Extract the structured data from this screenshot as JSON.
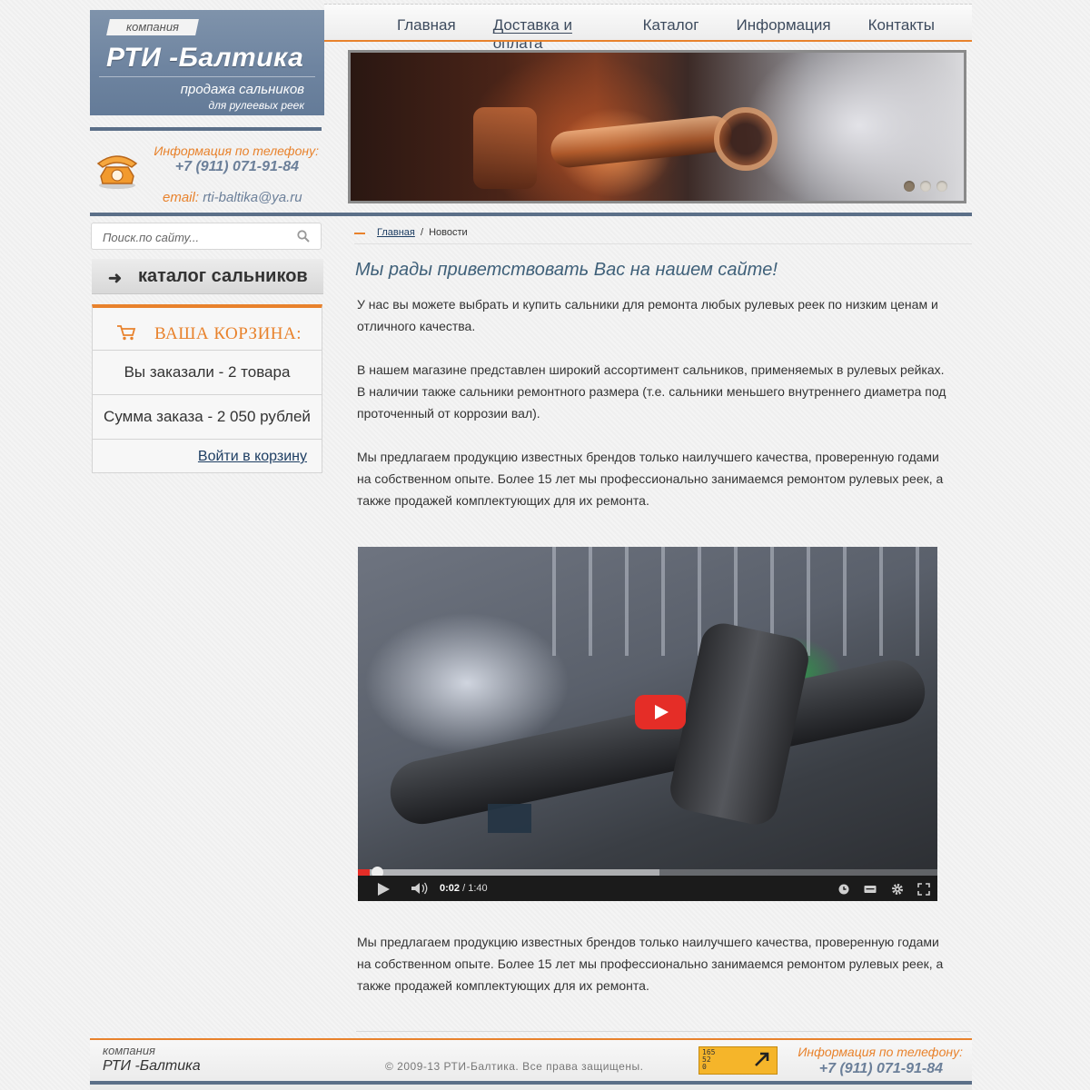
{
  "header": {
    "company_tag": "компания",
    "company_name": "РТИ -Балтика",
    "subtitle_1": "продажа сальников",
    "subtitle_2": "для рулеевых реек",
    "phone_label": "Информация по телефону:",
    "phone": "+7 (911) 071-91-84",
    "email_label": "email:",
    "email": "rti-baltika@ya.ru"
  },
  "nav": {
    "items": [
      "Главная",
      "Доставка и оплата",
      "Каталог",
      "Информация",
      "Контакты"
    ],
    "active": "Доставка и оплата"
  },
  "slider": {
    "slides": 3,
    "active_index": 0
  },
  "search": {
    "placeholder": "Поиск.по сайту..."
  },
  "sidebar": {
    "catalog_label": "каталог сальников",
    "cart_title": "ВАША КОРЗИНА:",
    "cart_items": "Вы заказали - 2 товара",
    "cart_sum": "Сумма заказа - 2 050 рублей",
    "cart_link": "Войти в корзину"
  },
  "breadcrumb": {
    "home": "Главная",
    "separator": "/",
    "current": "Новости"
  },
  "main": {
    "title": "Мы рады приветствовать Вас на нашем сайте!",
    "p1": "У нас вы можете выбрать и купить сальники для ремонта любых рулевых реек по низким ценам и отличного качества.",
    "p2": "В нашем магазине представлен широкий ассортимент сальников, применяемых в рулевых рейках. В наличии также сальники ремонтного размера (т.е. сальники меньшего внутреннего диаметра под проточенный от коррозии вал).",
    "p3": "Мы предлагаем продукцию известных брендов только наилучшего качества, проверенную годами на собственном опыте. Более 15 лет мы профессионально занимаемся ремонтом рулевых реек, а также продажей комплектующих для их ремонта.",
    "p4": "Мы предлагаем продукцию известных брендов только наилучшего качества, проверенную годами на собственном опыте. Более 15 лет мы профессионально занимаемся ремонтом рулевых реек, а также продажей комплектующих для их ремонта."
  },
  "video": {
    "current_time": "0:02",
    "separator": "/",
    "duration": "1:40",
    "played_fraction": 0.02,
    "loaded_fraction": 0.52
  },
  "footer": {
    "company_tag": "компания",
    "company_name": "РТИ -Балтика",
    "copyright": "© 2009-13 РТИ-Балтика. Все права защищены.",
    "counter_line1": "165",
    "counter_line2": "52",
    "counter_line3": "0",
    "phone_label": "Информация по телефону:",
    "phone": "+7 (911) 071-91-84"
  },
  "colors": {
    "accent": "#e8822c",
    "brand_blue": "#6b7f99",
    "bar": "#5b6f88",
    "link": "#1e3e63"
  }
}
